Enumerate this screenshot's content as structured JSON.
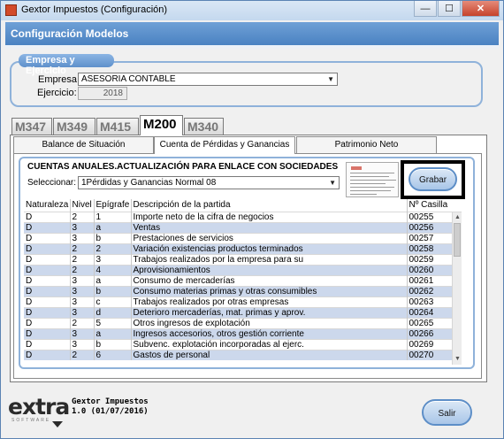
{
  "window": {
    "title": "Gextor Impuestos (Configuración)",
    "minimize": "—",
    "maximize": "☐",
    "close": "✕"
  },
  "header": {
    "title": "Configuración Modelos"
  },
  "empresa": {
    "legend": "Empresa y Ejercicio",
    "empresa_label": "Empresa:",
    "empresa_value": "ASESORIA CONTABLE",
    "ejercicio_label": "Ejercicio:",
    "ejercicio_value": "2018"
  },
  "model_tabs": [
    "M347",
    "M349",
    "M415",
    "M200",
    "M340"
  ],
  "active_model_tab": "M200",
  "sub_tabs": [
    "Balance de Situación",
    "Cuenta de Pérdidas y Ganancias",
    "Patrimonio Neto"
  ],
  "active_sub_tab": "Cuenta de Pérdidas y Ganancias",
  "section": {
    "title": "CUENTAS ANUALES.ACTUALIZACIÓN PARA ENLACE CON SOCIEDADES",
    "select_label": "Seleccionar:",
    "select_value": "1Pérdidas y Ganancias Normal 08",
    "save_button": "Grabar"
  },
  "table": {
    "columns": [
      "Naturaleza",
      "Nivel",
      "Epígrafe",
      "Descripción de la partida",
      "Nº Casilla"
    ],
    "rows": [
      [
        "D",
        "2",
        "1",
        "Importe neto de la cifra de negocios",
        "00255"
      ],
      [
        "D",
        "3",
        "a",
        "Ventas",
        "00256"
      ],
      [
        "D",
        "3",
        "b",
        "Prestaciones de servicios",
        "00257"
      ],
      [
        "D",
        "2",
        "2",
        "Variación existencias productos terminados",
        "00258"
      ],
      [
        "D",
        "2",
        "3",
        "Trabajos realizados por la empresa para su",
        "00259"
      ],
      [
        "D",
        "2",
        "4",
        "Aprovisionamientos",
        "00260"
      ],
      [
        "D",
        "3",
        "a",
        "Consumo de mercaderías",
        "00261"
      ],
      [
        "D",
        "3",
        "b",
        "Consumo materias primas y otras consumibles",
        "00262"
      ],
      [
        "D",
        "3",
        "c",
        "Trabajos realizados por otras empresas",
        "00263"
      ],
      [
        "D",
        "3",
        "d",
        "Deterioro mercaderías, mat. primas y  aprov.",
        "00264"
      ],
      [
        "D",
        "2",
        "5",
        "Otros ingresos de explotación",
        "00265"
      ],
      [
        "D",
        "3",
        "a",
        "Ingresos accesorios, otros gestión corriente",
        "00266"
      ],
      [
        "D",
        "3",
        "b",
        "Subvenc. explotación incorporadas al ejerc.",
        "00269"
      ],
      [
        "D",
        "2",
        "6",
        "Gastos de personal",
        "00270"
      ]
    ]
  },
  "footer": {
    "logo_text": "extra",
    "logo_sub": "SOFTWARE",
    "app_name": "Gextor Impuestos",
    "version": "1.0 (01/07/2016)",
    "exit_button": "Salir"
  },
  "colors": {
    "header": "#4a82c2",
    "row_alt": "#ccd8ec",
    "accent": "#8fb2da"
  }
}
